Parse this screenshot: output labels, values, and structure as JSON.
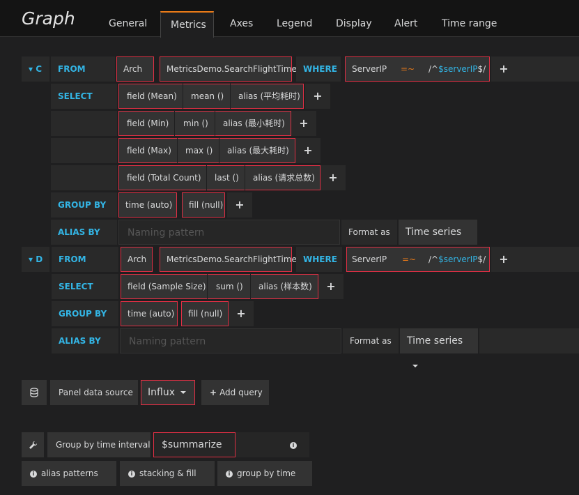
{
  "header": {
    "title": "Graph",
    "tabs": [
      {
        "label": "General"
      },
      {
        "label": "Metrics"
      },
      {
        "label": "Legend"
      },
      {
        "label": "Axes"
      },
      {
        "label": "Display"
      },
      {
        "label": "Alert"
      },
      {
        "label": "Time range"
      }
    ]
  },
  "queries": [
    {
      "ref": "C",
      "from_label": "FROM",
      "policy": "Arch",
      "measurement": "MetricsDemo.SearchFlightTime",
      "where_label": "WHERE",
      "where_key": "ServerIP",
      "where_op": "=~",
      "where_value_prefix": "/^",
      "where_value_var": "$serverIP",
      "where_value_suffix": "$/",
      "select_label": "SELECT",
      "selects": [
        {
          "field": "field (Mean)",
          "fn": "mean ()",
          "alias": "alias (平均耗时)"
        },
        {
          "field": "field (Min)",
          "fn": "min ()",
          "alias": "alias (最小耗时)"
        },
        {
          "field": "field (Max)",
          "fn": "max ()",
          "alias": "alias (最大耗时)"
        },
        {
          "field": "field (Total Count)",
          "fn": "last ()",
          "alias": "alias (请求总数)"
        }
      ],
      "group_by_label": "GROUP BY",
      "group_time": "time (auto)",
      "group_fill": "fill (null)",
      "alias_by_label": "ALIAS BY",
      "alias_placeholder": "Naming pattern",
      "format_label": "Format as",
      "format_value": "Time series"
    },
    {
      "ref": "D",
      "from_label": "FROM",
      "policy": "Arch",
      "measurement": "MetricsDemo.SearchFlightTime",
      "where_label": "WHERE",
      "where_key": "ServerIP",
      "where_op": "=~",
      "where_value_prefix": "/^",
      "where_value_var": "$serverIP",
      "where_value_suffix": "$/",
      "select_label": "SELECT",
      "selects": [
        {
          "field": "field (Sample Size)",
          "fn": "sum ()",
          "alias": "alias (样本数)"
        }
      ],
      "group_by_label": "GROUP BY",
      "group_time": "time (auto)",
      "group_fill": "fill (null)",
      "alias_by_label": "ALIAS BY",
      "alias_placeholder": "Naming pattern",
      "format_label": "Format as",
      "format_value": "Time series"
    }
  ],
  "datasource": {
    "label": "Panel data source",
    "value": "Influx",
    "add_query": "Add query"
  },
  "options": {
    "interval_label": "Group by time interval",
    "interval_value": "$summarize",
    "help": [
      "alias patterns",
      "stacking & fill",
      "group by time"
    ]
  },
  "colors": {
    "keyword": "#33b5e5",
    "operator": "#eb7b18",
    "highlight_box": "#e02f44"
  }
}
